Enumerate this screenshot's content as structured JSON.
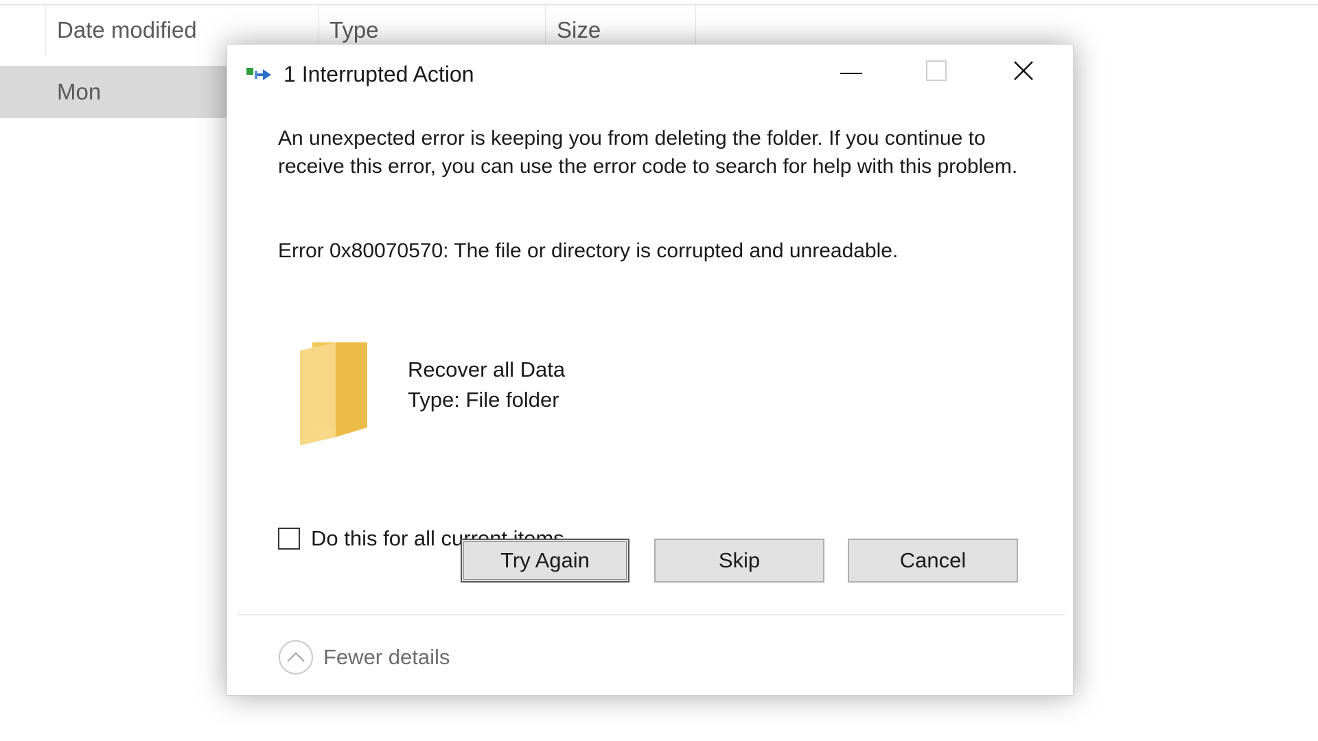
{
  "explorer": {
    "columns": [
      "Date modified",
      "Type",
      "Size"
    ],
    "selected_row_date": "Mon"
  },
  "dialog": {
    "title": "1 Interrupted Action",
    "title_icon": "file-move-icon",
    "window_controls": [
      "minimize-icon",
      "maximize-icon",
      "close-icon"
    ],
    "message": "An unexpected error is keeping you from deleting the folder. If you continue to receive this error, you can use the error code to search for help with this problem.",
    "error": "Error 0x80070570: The file or directory is corrupted and unreadable.",
    "item": {
      "icon": "folder-icon",
      "name": "Recover all Data",
      "type": "Type: File folder"
    },
    "checkbox": {
      "label": "Do this for all current items",
      "checked": false
    },
    "buttons": {
      "try_again": "Try Again",
      "skip": "Skip",
      "cancel": "Cancel"
    },
    "details_toggle": "Fewer details",
    "colors": {
      "folder": "#f3c85a",
      "button_bg": "#e1e1e1",
      "button_border": "#adadad"
    }
  }
}
